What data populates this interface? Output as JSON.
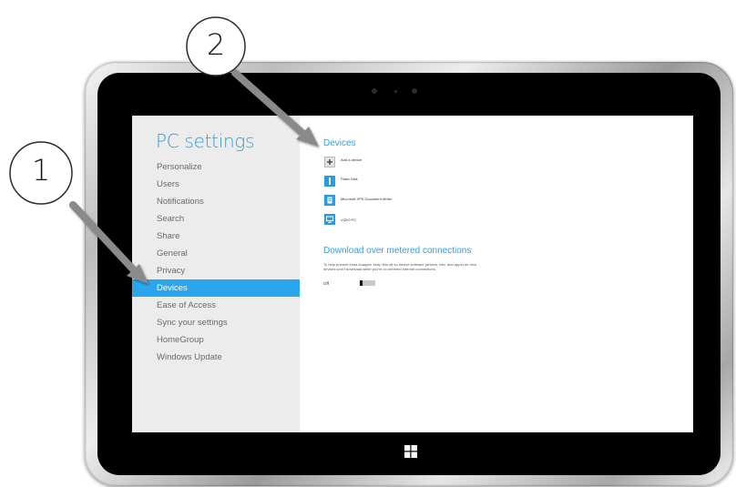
{
  "callouts": [
    {
      "number": "1"
    },
    {
      "number": "2"
    }
  ],
  "settings": {
    "title": "PC settings",
    "nav_items": [
      {
        "label": "Personalize"
      },
      {
        "label": "Users"
      },
      {
        "label": "Notifications"
      },
      {
        "label": "Search"
      },
      {
        "label": "Share"
      },
      {
        "label": "General"
      },
      {
        "label": "Privacy"
      },
      {
        "label": "Devices",
        "selected": true
      },
      {
        "label": "Ease of Access"
      },
      {
        "label": "Sync your settings"
      },
      {
        "label": "HomeGroup"
      },
      {
        "label": "Windows Update"
      }
    ]
  },
  "devices": {
    "title": "Devices",
    "items": [
      {
        "label": "Add a device",
        "icon": "plus-icon"
      },
      {
        "label": "Flash Disk",
        "icon": "usb-drive-icon"
      },
      {
        "label": "Microsoft XPS Document Writer",
        "icon": "printer-icon"
      },
      {
        "label": "VIZIO PC",
        "icon": "monitor-icon"
      }
    ]
  },
  "metered": {
    "title": "Download over metered connections",
    "description": "To help prevent extra charges, keep this off so device software (drivers, info, and apps) for new devices won't download while you're on metered Internet connections.",
    "toggle_label": "Off",
    "toggle_on": false
  },
  "colors": {
    "accent": "#2aa6ee",
    "left_pane_bg": "#ececec",
    "bezel": "#000000"
  }
}
